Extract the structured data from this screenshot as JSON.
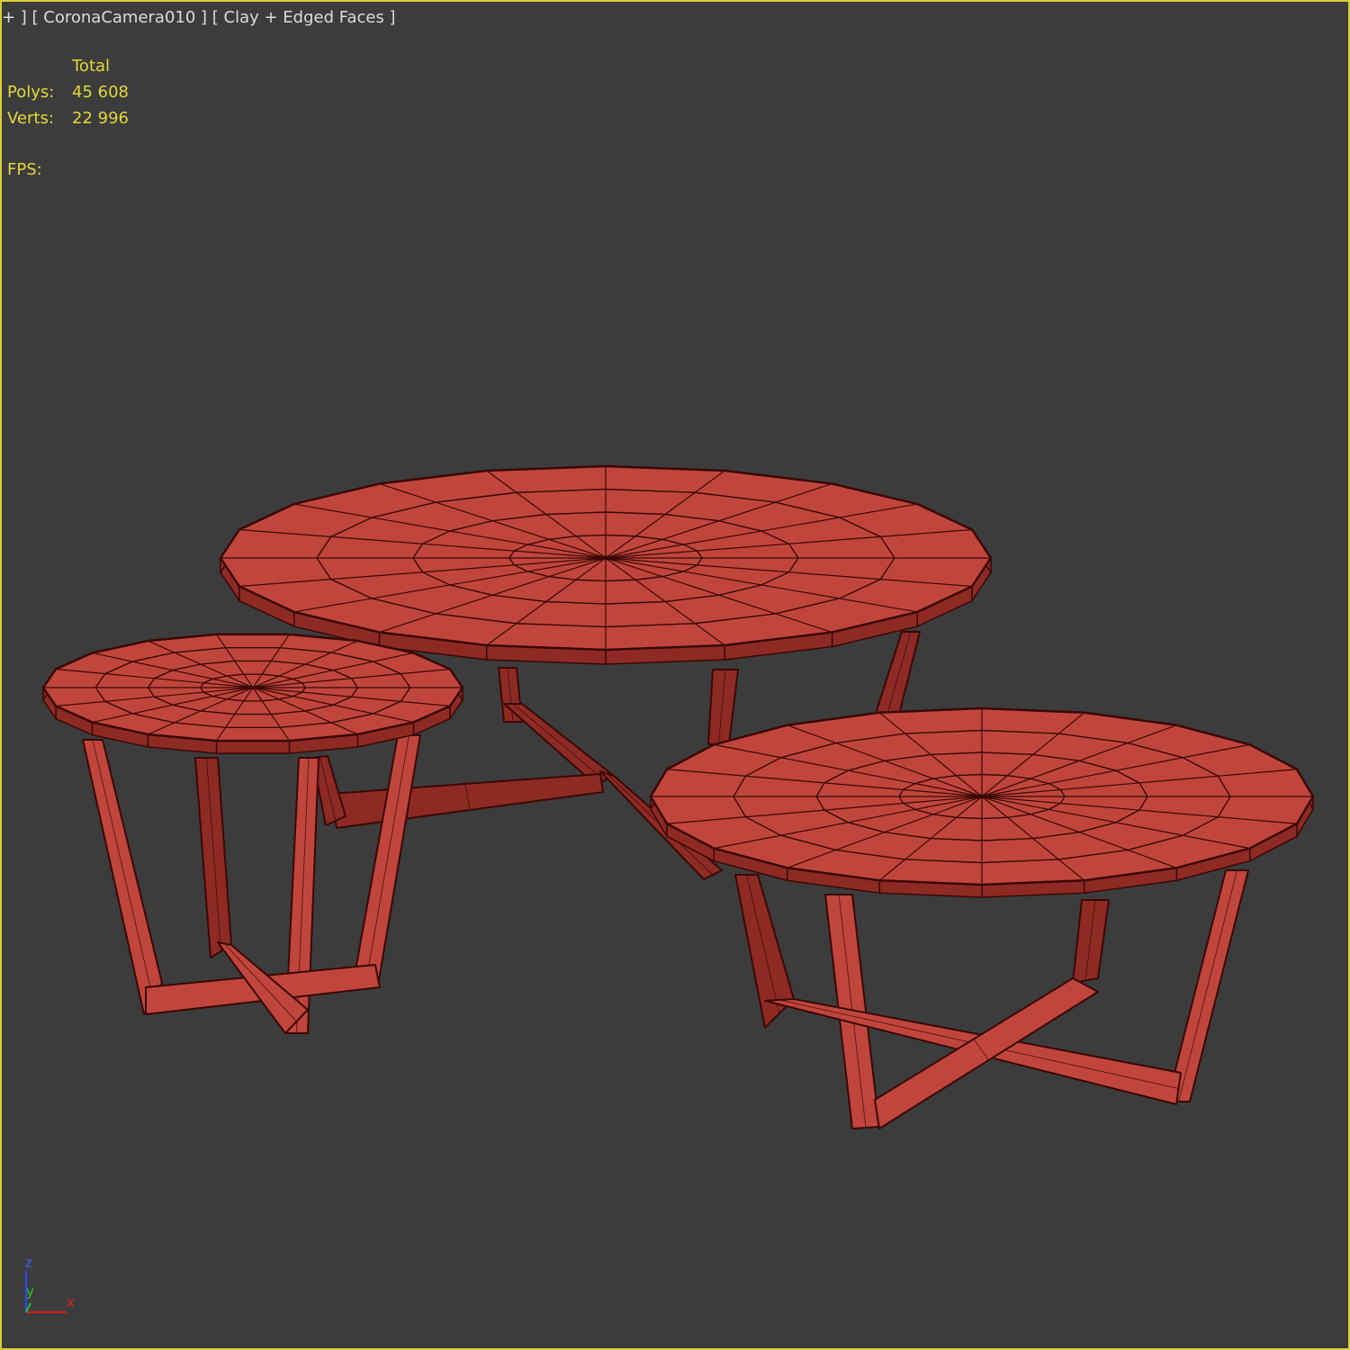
{
  "viewport": {
    "label": "+ ] [ CoronaCamera010 ] [ Clay + Edged Faces ]",
    "border_color": "#d8cf3a",
    "background": "#3c3c3c"
  },
  "stats": {
    "header": "Total",
    "polys_label": "Polys:",
    "polys_value": "45 608",
    "verts_label": "Verts:",
    "verts_value": "22 996",
    "fps_label": "FPS:",
    "text_color": "#e3d93a"
  },
  "model": {
    "fill": "#c0463d",
    "fill_dark": "#8e2a24",
    "edge": "#3a0805"
  },
  "axis_gizmo": {
    "x": "x",
    "y": "y",
    "z": "z"
  }
}
